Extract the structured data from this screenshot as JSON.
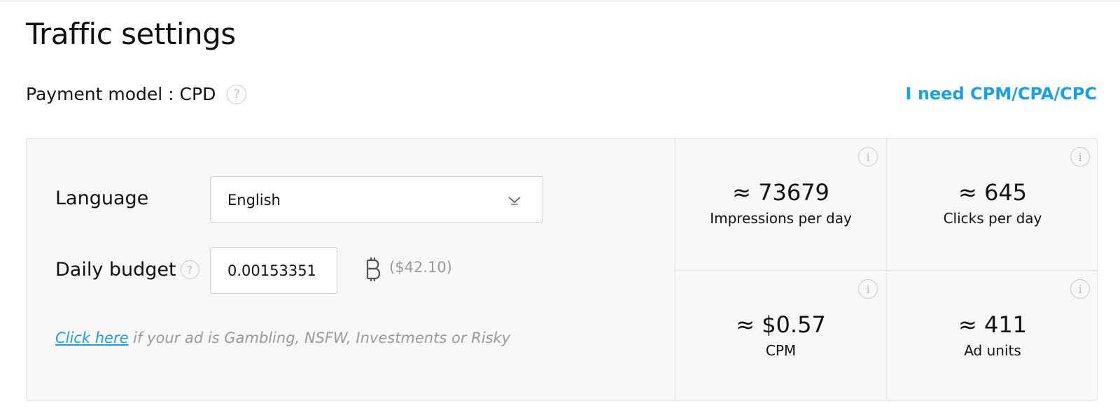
{
  "page": {
    "title": "Traffic settings"
  },
  "payment": {
    "label": "Payment model : CPD",
    "help_glyph": "?",
    "need_link": "I need CPM/CPA/CPC"
  },
  "form": {
    "language_label": "Language",
    "language_value": "English",
    "budget_label": "Daily budget",
    "budget_help_glyph": "?",
    "budget_value": "0.00153351",
    "currency_icon": "bitcoin-icon",
    "usd_value": "($42.10)",
    "risky_link": "Click here",
    "risky_text": " if your ad is Gambling, NSFW, Investments or Risky"
  },
  "stats": [
    {
      "value": "≈ 73679",
      "label": "Impressions per day"
    },
    {
      "value": "≈ 645",
      "label": "Clicks per day"
    },
    {
      "value": "≈ $0.57",
      "label": "CPM"
    },
    {
      "value": "≈ 411",
      "label": "Ad units"
    }
  ],
  "info_glyph": "i",
  "colors": {
    "accent": "#1aa0e6",
    "muted": "#9a9a9a",
    "panel_bg": "#f8f8f8",
    "border": "#e3e3e3"
  }
}
